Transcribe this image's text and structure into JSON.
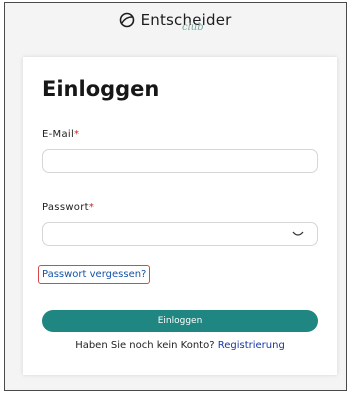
{
  "brand": {
    "name": "Entscheider",
    "sub": "club"
  },
  "login": {
    "title": "Einloggen",
    "email_label": "E-Mail",
    "email_value": "",
    "password_label": "Passwort",
    "password_value": "",
    "required_mark": "*",
    "forgot_link": "Passwort vergessen?",
    "submit_label": "Einloggen",
    "no_account_text": "Haben Sie noch kein Konto?",
    "register_link": "Registrierung"
  },
  "colors": {
    "accent": "#1f8682",
    "link": "#1536a6",
    "required": "#c32a2a",
    "highlight_border": "#d8474a"
  },
  "icons": {
    "logo": "leaf-circle-icon",
    "password_toggle": "eye-icon"
  }
}
